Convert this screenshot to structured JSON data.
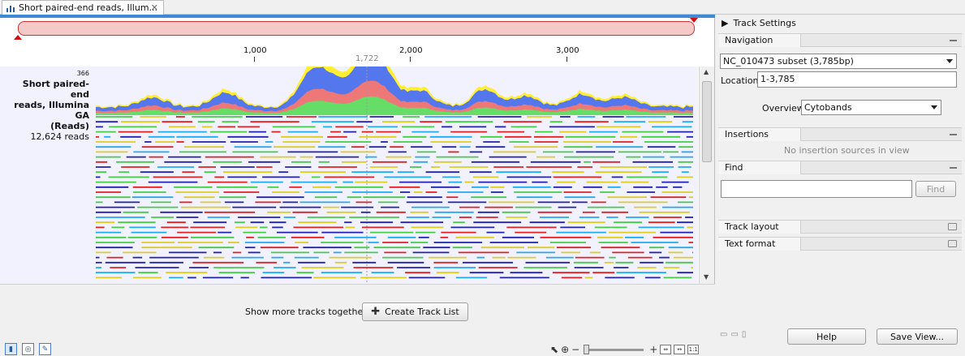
{
  "tab": {
    "title": "Short paired-end reads, Illum..."
  },
  "ruler": {
    "ticks": [
      "1,000",
      "2,000",
      "3,000"
    ],
    "cursor": "1,722"
  },
  "track": {
    "max_coverage": "366",
    "name_line1": "Short paired-end",
    "name_line2": "reads, Illumina GA",
    "name_line3": "(Reads)",
    "read_count": "12,624 reads"
  },
  "bottom": {
    "show_more_label": "Show more tracks together:",
    "create_track_list_label": "Create Track List"
  },
  "side": {
    "title": "Track Settings",
    "navigation": {
      "label": "Navigation",
      "sequence": "NC_010473 subset (3,785bp)",
      "location_label": "Location:",
      "location_value": "1-3,785",
      "overview_label": "Overview",
      "overview_value": "Cytobands"
    },
    "insertions": {
      "label": "Insertions",
      "message": "No insertion sources in view"
    },
    "find": {
      "label": "Find",
      "button": "Find"
    },
    "track_layout": {
      "label": "Track layout"
    },
    "text_format": {
      "label": "Text format"
    },
    "help_label": "Help",
    "save_view_label": "Save View..."
  },
  "colors": {
    "accent": "#3c8ad8",
    "overview_fill": "#f6c9c9",
    "overview_stroke": "#cc3333",
    "forward_read": "#2222aa",
    "reverse_read": "#dd2222",
    "paired_read": "#22aaee",
    "single_read": "#44cc44",
    "ambiguous_read": "#ddcc22"
  },
  "icons": [
    "chart-icon",
    "close-icon",
    "play-icon",
    "plus-icon",
    "pointer-icon",
    "zoom-in-icon",
    "zoom-out-icon",
    "folder-icon"
  ]
}
